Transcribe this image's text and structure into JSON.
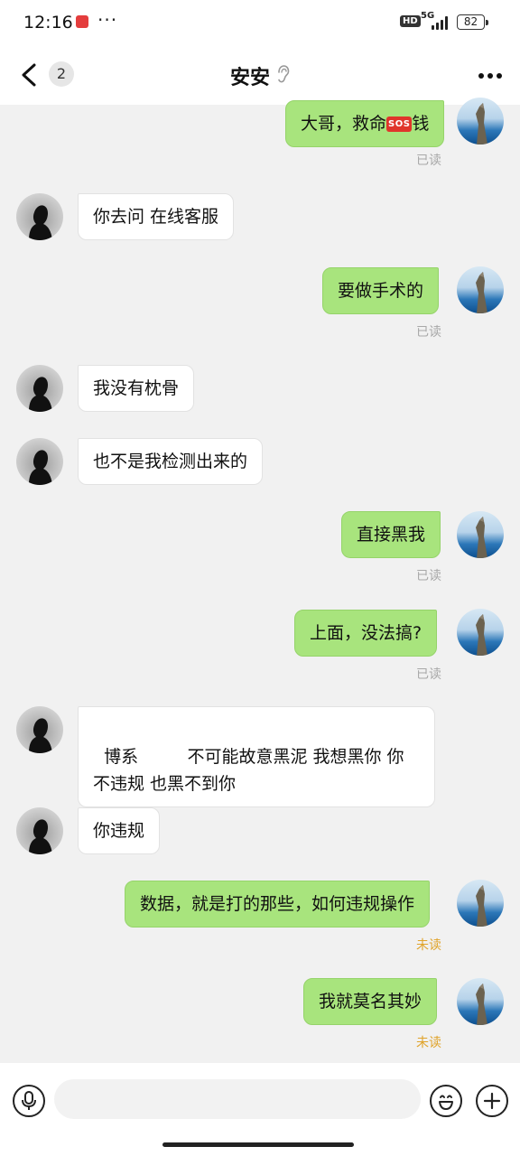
{
  "status_bar": {
    "time": "12:16",
    "app_icon": "notification-app-icon",
    "dots": "···",
    "hd_label": "HD",
    "network_label": "5G",
    "battery_level": "82",
    "icons": [
      "signal-icon",
      "battery-icon"
    ]
  },
  "nav_bar": {
    "back_badge": "2",
    "title": "安安",
    "icons": [
      "back-chevron-icon",
      "ear-icon",
      "more-icon"
    ]
  },
  "messages": [
    {
      "side": "self",
      "text": "大哥，救命",
      "badge": "SOS",
      "text_after": "钱",
      "receipt": "已读"
    },
    {
      "side": "peer",
      "text": "你去问 在线客服"
    },
    {
      "side": "self",
      "text": "要做手术的",
      "receipt": "已读"
    },
    {
      "side": "peer",
      "text": "我没有枕骨"
    },
    {
      "side": "peer",
      "text": "也不是我检测出来的"
    },
    {
      "side": "self",
      "text": "直接黑我",
      "receipt": "已读"
    },
    {
      "side": "self",
      "text": "上面，没法搞?",
      "receipt": "已读"
    },
    {
      "side": "peer",
      "text": "博系         不可能故意黑泥 我想黑你 你 不违规 也黑不到你"
    },
    {
      "side": "peer",
      "text": "你违规"
    },
    {
      "side": "self",
      "text": "数据，就是打的那些，如何违规操作",
      "receipt": "未读"
    },
    {
      "side": "self",
      "text": "我就莫名其妙",
      "receipt": "未读"
    }
  ],
  "input_bar": {
    "placeholder": "",
    "icons": [
      "microphone-icon",
      "emoji-icon",
      "plus-icon"
    ]
  },
  "colors": {
    "self_bubble": "#a8e47d",
    "peer_bubble": "#ffffff",
    "read_receipt": "#a8a8a8",
    "unread_receipt": "#e0a32a",
    "background": "#f1f1f1"
  }
}
